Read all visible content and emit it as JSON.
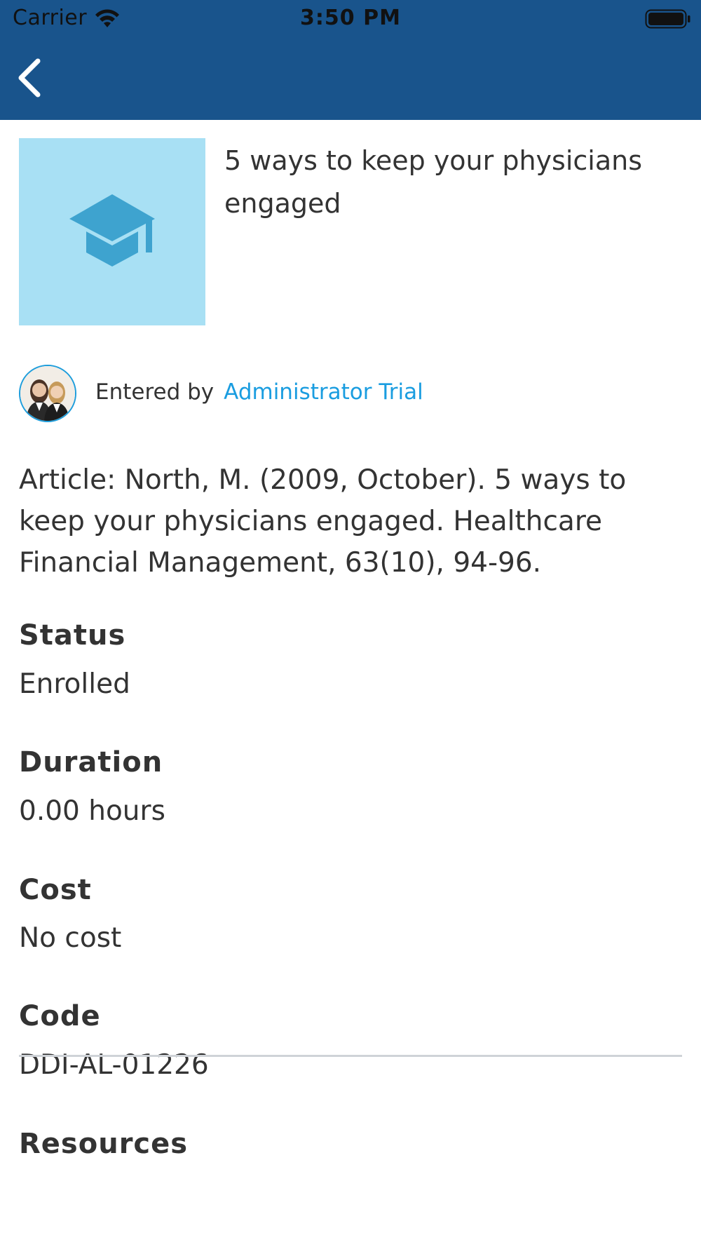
{
  "status_bar": {
    "carrier": "Carrier",
    "time": "3:50 PM"
  },
  "colors": {
    "header": "#19548c",
    "thumbnail_bg": "#a8e0f4",
    "icon": "#3ea3cf",
    "link": "#1a9de0"
  },
  "nav": {
    "back_icon": "chevron-left-icon"
  },
  "item": {
    "title": "5 ways to keep your physicians engaged",
    "thumbnail_icon": "graduation-cap-icon",
    "entered_by_label": "Entered by",
    "entered_by_name": "Administrator Trial",
    "description": "Article: North, M. (2009, October). 5 ways to keep your physicians engaged. Healthcare Financial Management, 63(10), 94-96."
  },
  "fields": {
    "status": {
      "label": "Status",
      "value": "Enrolled"
    },
    "duration": {
      "label": "Duration",
      "value": "0.00 hours"
    },
    "cost": {
      "label": "Cost",
      "value": "No cost"
    },
    "code": {
      "label": "Code",
      "value": "DDI-AL-01226"
    }
  },
  "resources": {
    "label": "Resources"
  }
}
